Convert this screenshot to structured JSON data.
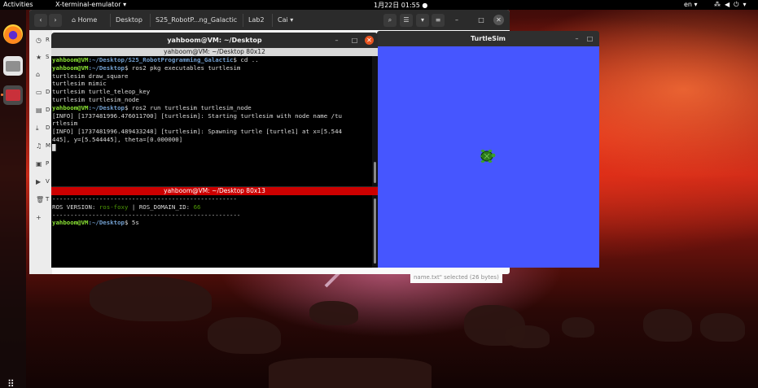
{
  "topbar": {
    "activities": "Activities",
    "app_menu": "X-terminal-emulator",
    "clock": "1月22日 01:55",
    "lang": "en"
  },
  "files": {
    "breadcrumbs": [
      "Home",
      "Desktop",
      "S25_RobotP...ng_Galactic",
      "Lab2",
      "Cai"
    ],
    "sidebar_letters": [
      "R",
      "S",
      "",
      "D",
      "D",
      "D",
      "M",
      "P",
      "V",
      "T",
      "+"
    ],
    "status": "name.txt\" selected (26 bytes)"
  },
  "turtlesim": {
    "title": "TurtleSim",
    "bg_color": "#4656ff"
  },
  "terminal": {
    "title": "yahboom@VM: ~/Desktop",
    "pane1_title": "yahboom@VM: ~/Desktop 80x12",
    "pane2_title": "yahboom@VM: ~/Desktop 80x13",
    "pane1_lines": [
      {
        "user": "yahboom@VM",
        "path": ":~/Desktop/S25_RobotProgramming_Galactic",
        "cmd": "$ cd .."
      },
      {
        "user": "yahboom@VM",
        "path": ":~/Desktop",
        "cmd": "$ ros2 pkg executables turtlesim"
      },
      {
        "text": "turtlesim draw_square"
      },
      {
        "text": "turtlesim mimic"
      },
      {
        "text": "turtlesim turtle_teleop_key"
      },
      {
        "text": "turtlesim turtlesim_node"
      },
      {
        "user": "yahboom@VM",
        "path": ":~/Desktop",
        "cmd": "$ ros2 run turtlesim turtlesim_node"
      },
      {
        "text": "[INFO] [1737481996.476011700] [turtlesim]: Starting turtlesim with node name /tu"
      },
      {
        "text": "rtlesim"
      },
      {
        "text": "[INFO] [1737481996.489433248] [turtlesim]: Spawning turtle [turtle1] at x=[5.544"
      },
      {
        "text": "445], y=[5.544445], theta=[0.000000]"
      },
      {
        "text": "█"
      }
    ],
    "pane2_lines": [
      {
        "text": "---------------------------------------------------"
      },
      {
        "ros": "ROS VERSION: ",
        "ros_val": "ros-foxy",
        "mid": " | ROS_DOMAIN_ID: ",
        "dom_val": "66"
      },
      {
        "text": "----------------------------------------------------"
      },
      {
        "user": "yahboom@VM",
        "path": ":~/Desktop",
        "cmd": "$ 5s"
      }
    ]
  },
  "colors": {
    "accent": "#e95420",
    "terminal_active_title": "#cc0000",
    "prompt_user": "#8ae234",
    "prompt_path": "#729fcf"
  }
}
